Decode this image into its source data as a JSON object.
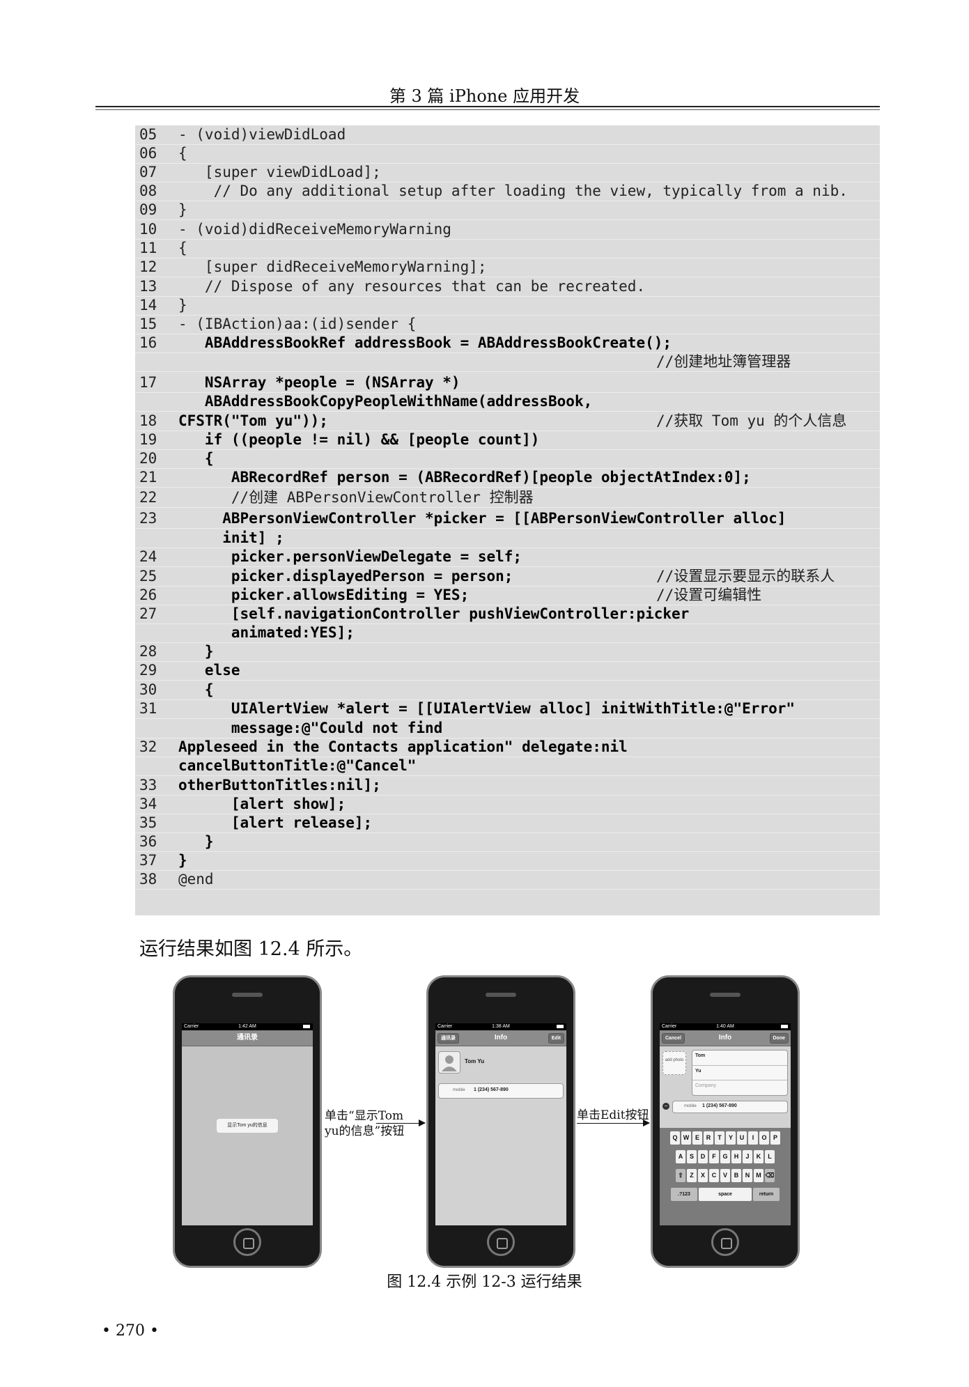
{
  "header": {
    "title": "第 3 篇    iPhone 应用开发"
  },
  "code": {
    "lines": [
      {
        "n": "05",
        "t": "- (void)viewDidLoad",
        "bold": false
      },
      {
        "n": "06",
        "t": "{",
        "bold": false
      },
      {
        "n": "07",
        "t": "   [super viewDidLoad];",
        "bold": false
      },
      {
        "n": "08",
        "t": "    // Do any additional setup after loading the view, typically from a nib.",
        "bold": false
      },
      {
        "n": "09",
        "t": "}",
        "bold": false
      },
      {
        "n": "10",
        "t": "- (void)didReceiveMemoryWarning",
        "bold": false
      },
      {
        "n": "11",
        "t": "{",
        "bold": false
      },
      {
        "n": "12",
        "t": "   [super didReceiveMemoryWarning];",
        "bold": false
      },
      {
        "n": "13",
        "t": "   // Dispose of any resources that can be recreated.",
        "bold": false
      },
      {
        "n": "14",
        "t": "}",
        "bold": false
      },
      {
        "n": "15",
        "t": "- (IBAction)aa:(id)sender {",
        "bold": false
      },
      {
        "n": "16",
        "t": "   ABAddressBookRef addressBook = ABAddressBookCreate();",
        "bold": true
      },
      {
        "n": "",
        "t": "",
        "bold": false,
        "c": "//创建地址簿管理器"
      },
      {
        "n": "17",
        "t": "   NSArray *people = (NSArray *)",
        "bold": true
      },
      {
        "n": "",
        "t": "   ABAddressBookCopyPeopleWithName(addressBook,",
        "bold": true
      },
      {
        "n": "18",
        "t": "CFSTR(\"Tom yu\"));",
        "bold": true,
        "c": "//获取 Tom yu 的个人信息"
      },
      {
        "n": "19",
        "t": "   if ((people != nil) && [people count])",
        "bold": true
      },
      {
        "n": "20",
        "t": "   {",
        "bold": true
      },
      {
        "n": "21",
        "t": "      ABRecordRef person = (ABRecordRef)[people objectAtIndex:0];",
        "bold": true
      },
      {
        "n": "22",
        "t": "      //创建 ABPersonViewController 控制器",
        "bold": false
      },
      {
        "n": "23",
        "t": "     ABPersonViewController *picker = [[ABPersonViewController alloc]",
        "bold": true
      },
      {
        "n": "",
        "t": "     init] ;",
        "bold": true
      },
      {
        "n": "24",
        "t": "      picker.personViewDelegate = self;",
        "bold": true
      },
      {
        "n": "25",
        "t": "      picker.displayedPerson = person;",
        "bold": true,
        "c": "//设置显示要显示的联系人"
      },
      {
        "n": "26",
        "t": "      picker.allowsEditing = YES;",
        "bold": true,
        "c": "//设置可编辑性"
      },
      {
        "n": "27",
        "t": "      [self.navigationController pushViewController:picker",
        "bold": true
      },
      {
        "n": "",
        "t": "      animated:YES];",
        "bold": true
      },
      {
        "n": "28",
        "t": "   }",
        "bold": true
      },
      {
        "n": "29",
        "t": "   else",
        "bold": true
      },
      {
        "n": "30",
        "t": "   {",
        "bold": true
      },
      {
        "n": "31",
        "t": "      UIAlertView *alert = [[UIAlertView alloc] initWithTitle:@\"Error\"",
        "bold": true
      },
      {
        "n": "",
        "t": "      message:@\"Could not find",
        "bold": true
      },
      {
        "n": "32",
        "t": "Appleseed in the Contacts application\" delegate:nil",
        "bold": true
      },
      {
        "n": "",
        "t": "cancelButtonTitle:@\"Cancel\"",
        "bold": true
      },
      {
        "n": "33",
        "t": "otherButtonTitles:nil];",
        "bold": true
      },
      {
        "n": "34",
        "t": "      [alert show];",
        "bold": true
      },
      {
        "n": "35",
        "t": "      [alert release];",
        "bold": true
      },
      {
        "n": "36",
        "t": "   }",
        "bold": true
      },
      {
        "n": "37",
        "t": "}",
        "bold": true
      },
      {
        "n": "38",
        "t": "@end",
        "bold": false
      }
    ]
  },
  "paragraph": "运行结果如图 12.4 所示。",
  "phones": {
    "p1": {
      "carrier": "Carrier",
      "time": "1:42 AM",
      "title": "通讯录",
      "button": "显示Tom yu的信息"
    },
    "p2": {
      "carrier": "Carrier",
      "time": "1:38 AM",
      "back": "通讯录",
      "title": "Info",
      "edit": "Edit",
      "name": "Tom Yu",
      "mobile_label": "mobile",
      "mobile": "1 (234) 567-890"
    },
    "p3": {
      "carrier": "Carrier",
      "time": "1:40 AM",
      "cancel": "Cancel",
      "title": "Info",
      "done": "Done",
      "add_photo": "add photo",
      "first": "Tom",
      "last": "Yu",
      "company": "Company",
      "mobile_label": "mobile",
      "mobile": "1 (234) 567-890",
      "keys_row1": [
        "Q",
        "W",
        "E",
        "R",
        "T",
        "Y",
        "U",
        "I",
        "O",
        "P"
      ],
      "keys_row2": [
        "A",
        "S",
        "D",
        "F",
        "G",
        "H",
        "J",
        "K",
        "L"
      ],
      "keys_row3": [
        "Z",
        "X",
        "C",
        "V",
        "B",
        "N",
        "M"
      ],
      "key_num": ".?123",
      "key_space": "space",
      "key_return": "return"
    }
  },
  "annotations": {
    "a1_line1": "单击“显示Tom",
    "a1_line2": "yu的信息”按钮",
    "a2": "单击Edit按钮"
  },
  "caption": "图 12.4    示例 12-3 运行结果",
  "page_number": "• 270 •"
}
